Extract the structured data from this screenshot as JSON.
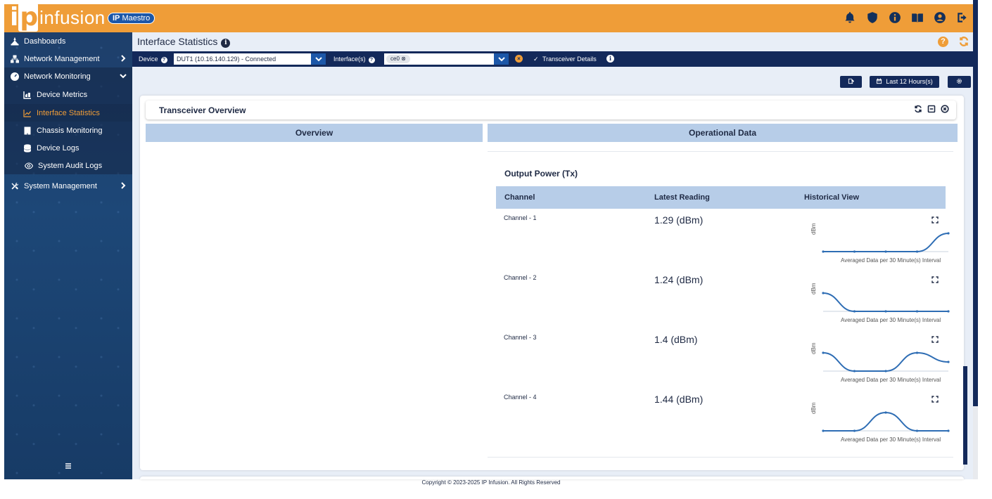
{
  "brand": {
    "logo_text": "infusion",
    "logo_ip": "ip",
    "product_tag_bold": "IP",
    "product_tag_rest": " Maestro"
  },
  "top_icons": [
    "bell-icon",
    "shield-icon",
    "info-icon",
    "book-icon",
    "user-icon",
    "logout-icon"
  ],
  "sidebar": {
    "items": [
      {
        "label": "Dashboards",
        "icon": "dashboard-icon"
      },
      {
        "label": "Network Management",
        "icon": "network-icon"
      },
      {
        "label": "Network Monitoring",
        "icon": "gauge-icon"
      },
      {
        "label": "Device Metrics",
        "icon": "chart-area-icon"
      },
      {
        "label": "Interface Statistics",
        "icon": "chart-line-icon"
      },
      {
        "label": "Chassis Monitoring",
        "icon": "building-icon"
      },
      {
        "label": "Device Logs",
        "icon": "database-icon"
      },
      {
        "label": "System Audit Logs",
        "icon": "eye-icon"
      },
      {
        "label": "System Management",
        "icon": "tools-icon"
      }
    ]
  },
  "header": {
    "title": "Interface Statistics"
  },
  "filters": {
    "device_label": "Device",
    "device_value": "DUT1 (10.16.140.129) - Connected",
    "interface_label": "Interface(s)",
    "interface_chip": "ce0",
    "transceiver_label": "Transceiver Details"
  },
  "actions": {
    "time_range": "Last 12 Hours(s)"
  },
  "widget": {
    "title": "Transceiver Overview",
    "overview_header": "Overview",
    "operational_header": "Operational Data",
    "section_title": "Output Power (Tx)",
    "columns": [
      "Channel",
      "Latest Reading",
      "Historical View"
    ],
    "rows": [
      {
        "channel": "Channel - 1",
        "reading": "1.29 (dBm)",
        "spark": [
          0,
          0,
          0,
          0,
          1
        ]
      },
      {
        "channel": "Channel - 2",
        "reading": "1.24 (dBm)",
        "spark": [
          1,
          0,
          0,
          0,
          0
        ]
      },
      {
        "channel": "Channel - 3",
        "reading": "1.4 (dBm)",
        "spark": [
          1,
          0,
          0,
          1,
          0.5
        ]
      },
      {
        "channel": "Channel - 4",
        "reading": "1.44 (dBm)",
        "spark": [
          0,
          0,
          1,
          0,
          0
        ]
      }
    ],
    "y_label": "dBm",
    "caption": "Averaged Data per 30 Minute(s) Interval"
  },
  "footer": {
    "copyright": "Copyright © 2023-2025 IP Infusion. All Rights Reserved"
  }
}
